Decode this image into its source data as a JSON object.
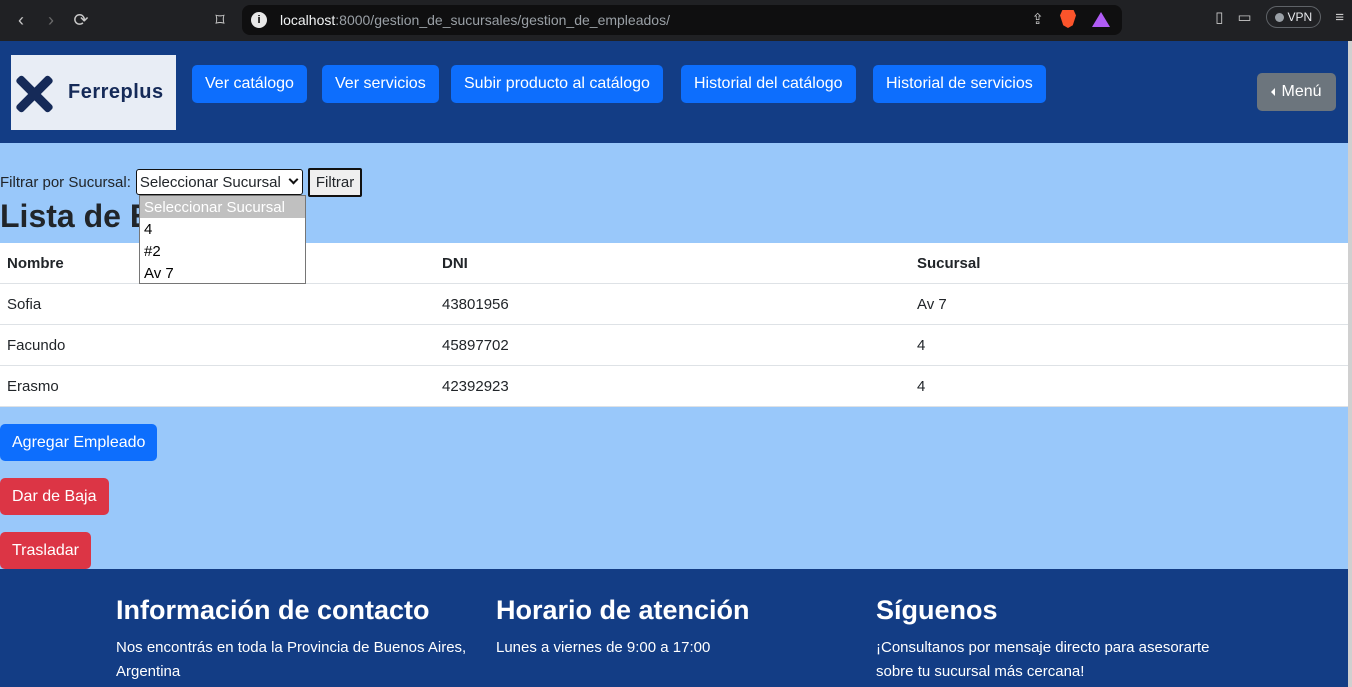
{
  "browser": {
    "url_host": "localhost",
    "url_path": ":8000/gestion_de_sucursales/gestion_de_empleados/",
    "vpn_label": "VPN"
  },
  "header": {
    "logo_text": "Ferreplus",
    "nav": [
      "Ver catálogo",
      "Ver servicios",
      "Subir producto al catálogo",
      "Historial del catálogo",
      "Historial de servicios"
    ],
    "menu_label": "Menú"
  },
  "filter": {
    "label": "Filtrar por Sucursal:",
    "selected": "Seleccionar Sucursal",
    "button": "Filtrar",
    "options": [
      "Seleccionar Sucursal",
      "4",
      "#2",
      "Av 7"
    ]
  },
  "main": {
    "title": "Lista de Empleados"
  },
  "table": {
    "headers": [
      "Nombre",
      "DNI",
      "Sucursal"
    ],
    "rows": [
      [
        "Sofia",
        "43801956",
        "Av 7"
      ],
      [
        "Facundo",
        "45897702",
        "4"
      ],
      [
        "Erasmo",
        "42392923",
        "4"
      ]
    ]
  },
  "actions": {
    "add": "Agregar Empleado",
    "remove": "Dar de Baja",
    "transfer": "Trasladar"
  },
  "footer": {
    "contact_title": "Información de contacto",
    "contact_text": "Nos encontrás en toda la Provincia de Buenos Aires, Argentina",
    "hours_title": "Horario de atención",
    "hours_text": "Lunes a viernes de 9:00 a 17:00",
    "follow_title": "Síguenos",
    "follow_text": "¡Consultanos por mensaje directo para asesorarte sobre tu sucursal más cercana!"
  },
  "colors": {
    "header_bg": "#133d85",
    "page_bg": "#99c8fa",
    "primary": "#0d6efd",
    "danger": "#dc3545",
    "secondary": "#6c757d"
  }
}
